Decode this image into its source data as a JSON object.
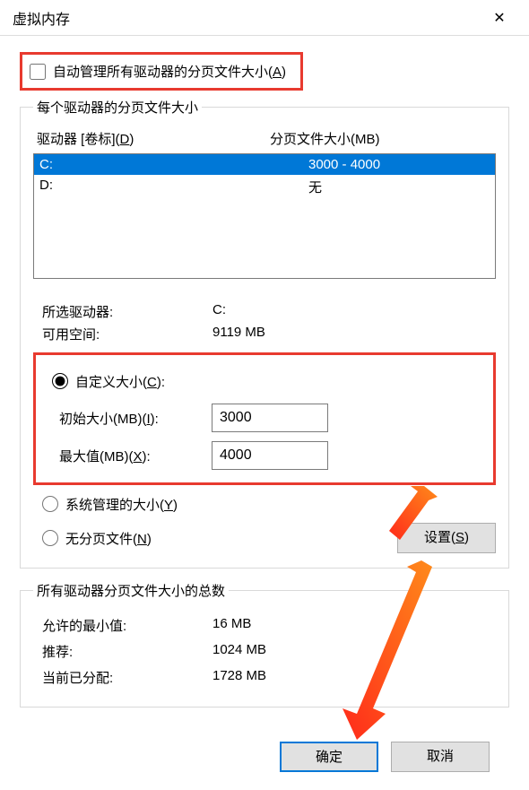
{
  "window": {
    "title": "虚拟内存",
    "close": "✕"
  },
  "auto": {
    "label_pre": "自动管理所有驱动器的分页文件大小(",
    "hotkey": "A",
    "label_post": ")"
  },
  "group1": {
    "legend": "每个驱动器的分页文件大小",
    "header": {
      "drive_pre": "驱动器 [卷标](",
      "drive_hotkey": "D",
      "drive_post": ")",
      "size": "分页文件大小(MB)"
    },
    "rows": [
      {
        "drive": "C:",
        "size": "3000 - 4000",
        "selected": true
      },
      {
        "drive": "D:",
        "size": "无",
        "selected": false
      }
    ],
    "selected_label": "所选驱动器:",
    "selected_value": "C:",
    "free_label": "可用空间:",
    "free_value": "9119 MB",
    "custom": {
      "radio_pre": "自定义大小(",
      "radio_hotkey": "C",
      "radio_post": "):",
      "initial_pre": "初始大小(MB)(",
      "initial_hotkey": "I",
      "initial_post": "):",
      "initial_value": "3000",
      "max_pre": "最大值(MB)(",
      "max_hotkey": "X",
      "max_post": "):",
      "max_value": "4000"
    },
    "system_pre": "系统管理的大小(",
    "system_hotkey": "Y",
    "system_post": ")",
    "none_pre": "无分页文件(",
    "none_hotkey": "N",
    "none_post": ")",
    "set_pre": "设置(",
    "set_hotkey": "S",
    "set_post": ")"
  },
  "group2": {
    "legend": "所有驱动器分页文件大小的总数",
    "min_label": "允许的最小值:",
    "min_value": "16 MB",
    "rec_label": "推荐:",
    "rec_value": "1024 MB",
    "cur_label": "当前已分配:",
    "cur_value": "1728 MB"
  },
  "buttons": {
    "ok": "确定",
    "cancel": "取消"
  }
}
